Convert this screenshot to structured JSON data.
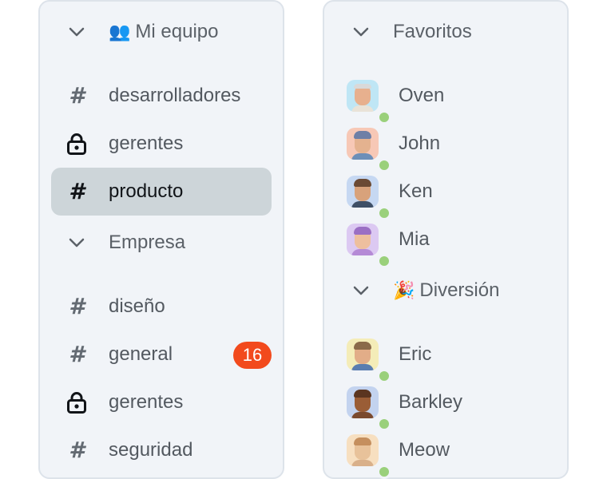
{
  "left_panel": {
    "sections": [
      {
        "title": "Mi equipo",
        "emoji": "👥",
        "channels": [
          {
            "name": "desarrolladores",
            "icon": "hash-icon",
            "selected": false
          },
          {
            "name": "gerentes",
            "icon": "lock-icon",
            "selected": false
          },
          {
            "name": "producto",
            "icon": "hash-icon",
            "selected": true
          }
        ]
      },
      {
        "title": "Empresa",
        "emoji": "",
        "channels": [
          {
            "name": "diseño",
            "icon": "hash-icon",
            "selected": false
          },
          {
            "name": "general",
            "icon": "hash-icon",
            "selected": false,
            "badge": "16"
          },
          {
            "name": "gerentes",
            "icon": "lock-icon",
            "selected": false
          },
          {
            "name": "seguridad",
            "icon": "hash-icon",
            "selected": false
          }
        ]
      }
    ]
  },
  "right_panel": {
    "sections": [
      {
        "title": "Favoritos",
        "emoji": "",
        "people": [
          {
            "name": "Oven",
            "status": "online",
            "avatar_bg": "#bfe6f5"
          },
          {
            "name": "John",
            "status": "online",
            "avatar_bg": "#f7c8b6"
          },
          {
            "name": "Ken",
            "status": "online",
            "avatar_bg": "#c6d8f2"
          },
          {
            "name": "Mia",
            "status": "online",
            "avatar_bg": "#dcc9f2"
          }
        ]
      },
      {
        "title": "Diversión",
        "emoji": "🎉",
        "people": [
          {
            "name": "Eric",
            "status": "online",
            "avatar_bg": "#f4ecb8"
          },
          {
            "name": "Barkley",
            "status": "online",
            "avatar_bg": "#c3d3ef"
          },
          {
            "name": "Meow",
            "status": "online",
            "avatar_bg": "#f7dfc0"
          }
        ]
      }
    ]
  },
  "colors": {
    "badge": "#f24a1d",
    "status_online": "#9ad07b",
    "selected_row": "#cdd5d9",
    "panel_bg": "#f1f4f8"
  }
}
